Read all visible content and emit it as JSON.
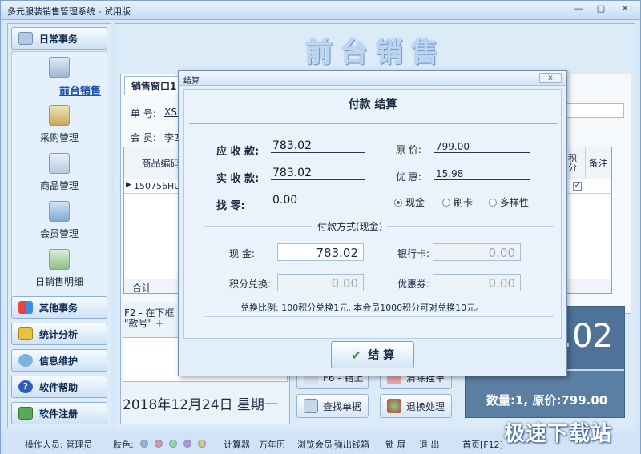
{
  "app": {
    "title": "多元服装销售管理系统 - 试用版"
  },
  "sidebar": {
    "daily_label": "日常事务",
    "items": [
      {
        "label": "前台销售",
        "active": true
      },
      {
        "label": "采购管理"
      },
      {
        "label": "商品管理"
      },
      {
        "label": "会员管理"
      },
      {
        "label": "日销售明细"
      }
    ],
    "other_label": "其他事务",
    "stats_label": "统计分析",
    "info_label": "信息维护",
    "help_label": "软件帮助",
    "register_label": "软件注册"
  },
  "main": {
    "big_title": "前台销售",
    "tab": "销售窗口1",
    "order_label": "单 号:",
    "order_value": "XSD2",
    "member_label": "会 员:",
    "member_value": "李四",
    "grid_header_code": "商品编码",
    "grid_row_code": "150756HUI1",
    "grid_header_points": "积分",
    "grid_header_note": "备注",
    "total_row_label": "合计",
    "hint_text": "F2 - 在下框\n\"款号\" +",
    "date_text": "2018年12月24日 星期一",
    "total_amount": "3.02",
    "summary_text": "数量:1, 原价:799.00",
    "btn_f6": "F6 - 错上",
    "btn_clear": "清除挂单",
    "btn_search": "查找单据",
    "btn_return": "退换处理"
  },
  "statusbar": {
    "operator": "操作人员: 管理员",
    "skin": "肤色:",
    "calculator": "计算器",
    "calendar": "万年历",
    "browse_member": "浏览会员",
    "cash_drawer": "弹出钱箱",
    "lock_screen": "锁 屏",
    "exit": "退 出",
    "home": "首页[F12]",
    "skin_colors": [
      "#8fb3d9",
      "#d98fc0",
      "#8fd9a8",
      "#b48fd9",
      "#d9c28f"
    ]
  },
  "watermark": "极速下载站",
  "dialog": {
    "title": "结算",
    "close": "x",
    "heading": "付款 结算",
    "due_label": "应 收 款:",
    "due_value": "783.02",
    "received_label": "实 收 款:",
    "received_value": "783.02",
    "change_label": "找    零:",
    "change_value": "0.00",
    "original_label": "原     价:",
    "original_value": "799.00",
    "discount_label": "优     惠:",
    "discount_value": "15.98",
    "radio_cash": "现金",
    "radio_card": "刷卡",
    "radio_mixed": "多样性",
    "pay_method_title": "付款方式(现金)",
    "cash_label": "现     金:",
    "cash_value": "783.02",
    "bankcard_label": "银行卡:",
    "bankcard_value": "0.00",
    "points_label": "积分兑换:",
    "points_value": "0.00",
    "coupon_label": "优惠券:",
    "coupon_value": "0.00",
    "exchange_text": "兑换比例: 100积分兑换1元, 本会员1000积分可对兑换10元。",
    "confirm_label": "结 算"
  }
}
